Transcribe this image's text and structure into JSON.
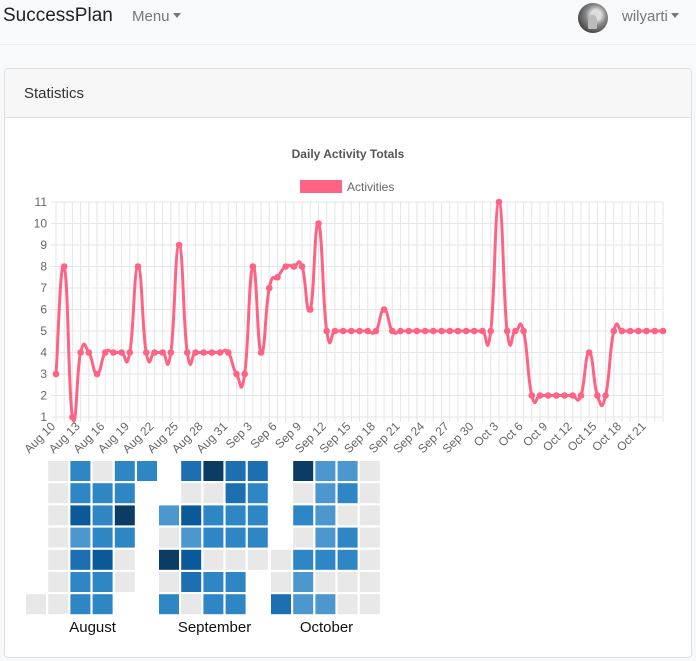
{
  "navbar": {
    "brand": "SuccessPlan",
    "menu_label": "Menu",
    "username": "wilyarti"
  },
  "card": {
    "title": "Statistics"
  },
  "colors": {
    "line": "#ff6384",
    "grid": "#e6e6e6",
    "heat_empty": "#e8e8e8",
    "heat_levels": [
      "#9fc0de",
      "#7aaed7",
      "#4d97cf",
      "#2f86c5",
      "#1c6fb0",
      "#0a5a9a",
      "#0b3c63"
    ]
  },
  "chart_data": [
    {
      "type": "line",
      "title": "Daily Activity Totals",
      "legend_position": "top",
      "grid": true,
      "ylim": [
        1,
        11
      ],
      "yticks": [
        "1",
        "2",
        "3",
        "4",
        "5",
        "6",
        "7",
        "8",
        "9",
        "10",
        "11"
      ],
      "xtick_labels": [
        "Aug 10",
        "Aug 13",
        "Aug 16",
        "Aug 19",
        "Aug 22",
        "Aug 25",
        "Aug 28",
        "Aug 31",
        "Sep 3",
        "Sep 6",
        "Sep 9",
        "Sep 12",
        "Sep 15",
        "Sep 18",
        "Sep 21",
        "Sep 24",
        "Sep 27",
        "Sep 30",
        "Oct 3",
        "Oct 6",
        "Oct 9",
        "Oct 12",
        "Oct 15",
        "Oct 18",
        "Oct 21"
      ],
      "series": [
        {
          "name": "Activities",
          "x": [
            "Aug 10",
            "Aug 11",
            "Aug 12",
            "Aug 13",
            "Aug 14",
            "Aug 15",
            "Aug 16",
            "Aug 17",
            "Aug 18",
            "Aug 19",
            "Aug 20",
            "Aug 21",
            "Aug 22",
            "Aug 23",
            "Aug 24",
            "Aug 25",
            "Aug 26",
            "Aug 27",
            "Aug 28",
            "Aug 29",
            "Aug 30",
            "Aug 31",
            "Sep 1",
            "Sep 2",
            "Sep 3",
            "Sep 4",
            "Sep 5",
            "Sep 6",
            "Sep 7",
            "Sep 8",
            "Sep 9",
            "Sep 10",
            "Sep 11",
            "Sep 12",
            "Sep 13",
            "Sep 14",
            "Sep 15",
            "Sep 16",
            "Sep 17",
            "Sep 18",
            "Sep 19",
            "Sep 20",
            "Sep 21",
            "Sep 22",
            "Sep 23",
            "Sep 24",
            "Sep 25",
            "Sep 26",
            "Sep 27",
            "Sep 28",
            "Sep 29",
            "Sep 30",
            "Oct 1",
            "Oct 2",
            "Oct 3",
            "Oct 4",
            "Oct 5",
            "Oct 6",
            "Oct 7",
            "Oct 8",
            "Oct 9",
            "Oct 10",
            "Oct 11",
            "Oct 12",
            "Oct 13",
            "Oct 14",
            "Oct 15",
            "Oct 16",
            "Oct 17",
            "Oct 18",
            "Oct 19",
            "Oct 20",
            "Oct 21",
            "Oct 22",
            "Oct 23"
          ],
          "values": [
            3,
            8,
            1,
            4,
            4,
            3,
            4,
            4,
            4,
            4,
            8,
            4,
            4,
            4,
            4,
            9,
            4,
            4,
            4,
            4,
            4,
            4,
            3,
            3,
            8,
            4,
            7,
            7.5,
            8,
            8,
            8,
            6,
            10,
            5,
            5,
            5,
            5,
            5,
            5,
            5,
            6,
            5,
            5,
            5,
            5,
            5,
            5,
            5,
            5,
            5,
            5,
            5,
            5,
            5,
            11,
            5,
            5,
            5,
            2,
            2,
            2,
            2,
            2,
            2,
            2,
            4,
            2,
            2,
            5,
            5,
            5,
            5,
            5,
            5,
            5
          ]
        }
      ]
    },
    {
      "type": "heatmap",
      "months": [
        {
          "name": "August",
          "weeks": [
            [
              null,
              null,
              null,
              null,
              null,
              null,
              0
            ],
            [
              0,
              0,
              0,
              0,
              0,
              0,
              0
            ],
            [
              3,
              3,
              5,
              2,
              4,
              3,
              3
            ],
            [
              0,
              3,
              3,
              3,
              5,
              3,
              3
            ],
            [
              3,
              3,
              6,
              3,
              0,
              0,
              null
            ],
            [
              3,
              null,
              null,
              null,
              null,
              null,
              null
            ]
          ]
        },
        {
          "name": "September",
          "weeks": [
            [
              null,
              null,
              2,
              0,
              6,
              0,
              3
            ],
            [
              4,
              0,
              5,
              2,
              5,
              4,
              0
            ],
            [
              6,
              0,
              3,
              3,
              0,
              3,
              3
            ],
            [
              4,
              4,
              3,
              3,
              0,
              3,
              3
            ],
            [
              4,
              3,
              3,
              3,
              0,
              null,
              null
            ]
          ]
        },
        {
          "name": "October",
          "weeks": [
            [
              null,
              null,
              null,
              null,
              0,
              0,
              4
            ],
            [
              6,
              0,
              3,
              0,
              3,
              2,
              2
            ],
            [
              2,
              2,
              2,
              2,
              3,
              0,
              2
            ],
            [
              2,
              3,
              0,
              3,
              3,
              0,
              0
            ],
            [
              0,
              0,
              0,
              0,
              0,
              0,
              0
            ]
          ]
        }
      ]
    }
  ]
}
